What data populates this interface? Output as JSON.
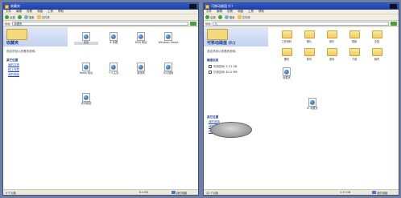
{
  "left": {
    "title": "收藏夹",
    "menu": [
      "文件",
      "编辑",
      "查看",
      "收藏",
      "工具",
      "帮助"
    ],
    "toolbar": {
      "back": "后退",
      "search": "搜索",
      "folders": "文件夹"
    },
    "address": {
      "label": "地址",
      "value": "收藏夹"
    },
    "taskpane": {
      "title": "收藏夹",
      "desc": "选定项目以查看其说明。",
      "section": "其它位置",
      "links": [
        "我的文档",
        "网上邻居",
        "我的电脑"
      ]
    },
    "files": [
      {
        "label": "链接",
        "selected": true
      },
      {
        "label": "IE 收藏"
      },
      {
        "label": "MSN 网站"
      },
      {
        "label": "Windows Media"
      },
      {
        "label": "Radio 电台"
      },
      {
        "label": "个人主页"
      },
      {
        "label": "新浪网"
      },
      {
        "label": "中文搜索"
      },
      {
        "label": "资讯频道"
      }
    ],
    "status": {
      "count": "9 个对象",
      "size": "8.4 KB",
      "zone": "我的电脑"
    }
  },
  "right": {
    "title": "可移动磁盘 (I:)",
    "menu": [
      "文件",
      "编辑",
      "查看",
      "收藏",
      "工具",
      "帮助"
    ],
    "toolbar": {
      "back": "后退",
      "search": "搜索",
      "folders": "文件夹"
    },
    "address": {
      "label": "地址",
      "value": "I:\\"
    },
    "taskpane": {
      "title": "可移动磁盘 (I:)",
      "desc": "选定项目以查看其说明。",
      "details_heading": "磁盘信息",
      "disk_rows": [
        "可用空间: 1.21 GB",
        "已用空间: 61.0 MB"
      ],
      "section": "其它位置",
      "links": [
        "我的电脑",
        "我的文档",
        "网上邻居"
      ]
    },
    "folders": [
      "工作资料",
      "照片",
      "音乐",
      "视频",
      "文档",
      "备份",
      "软件",
      "游戏",
      "下载",
      "临时"
    ],
    "files": [
      {
        "label": "收藏夹"
      },
      {
        "label": "IE 收藏夹"
      }
    ],
    "status": {
      "count": "12 个对象",
      "size": "1.21 GB",
      "zone": "我的电脑"
    }
  }
}
